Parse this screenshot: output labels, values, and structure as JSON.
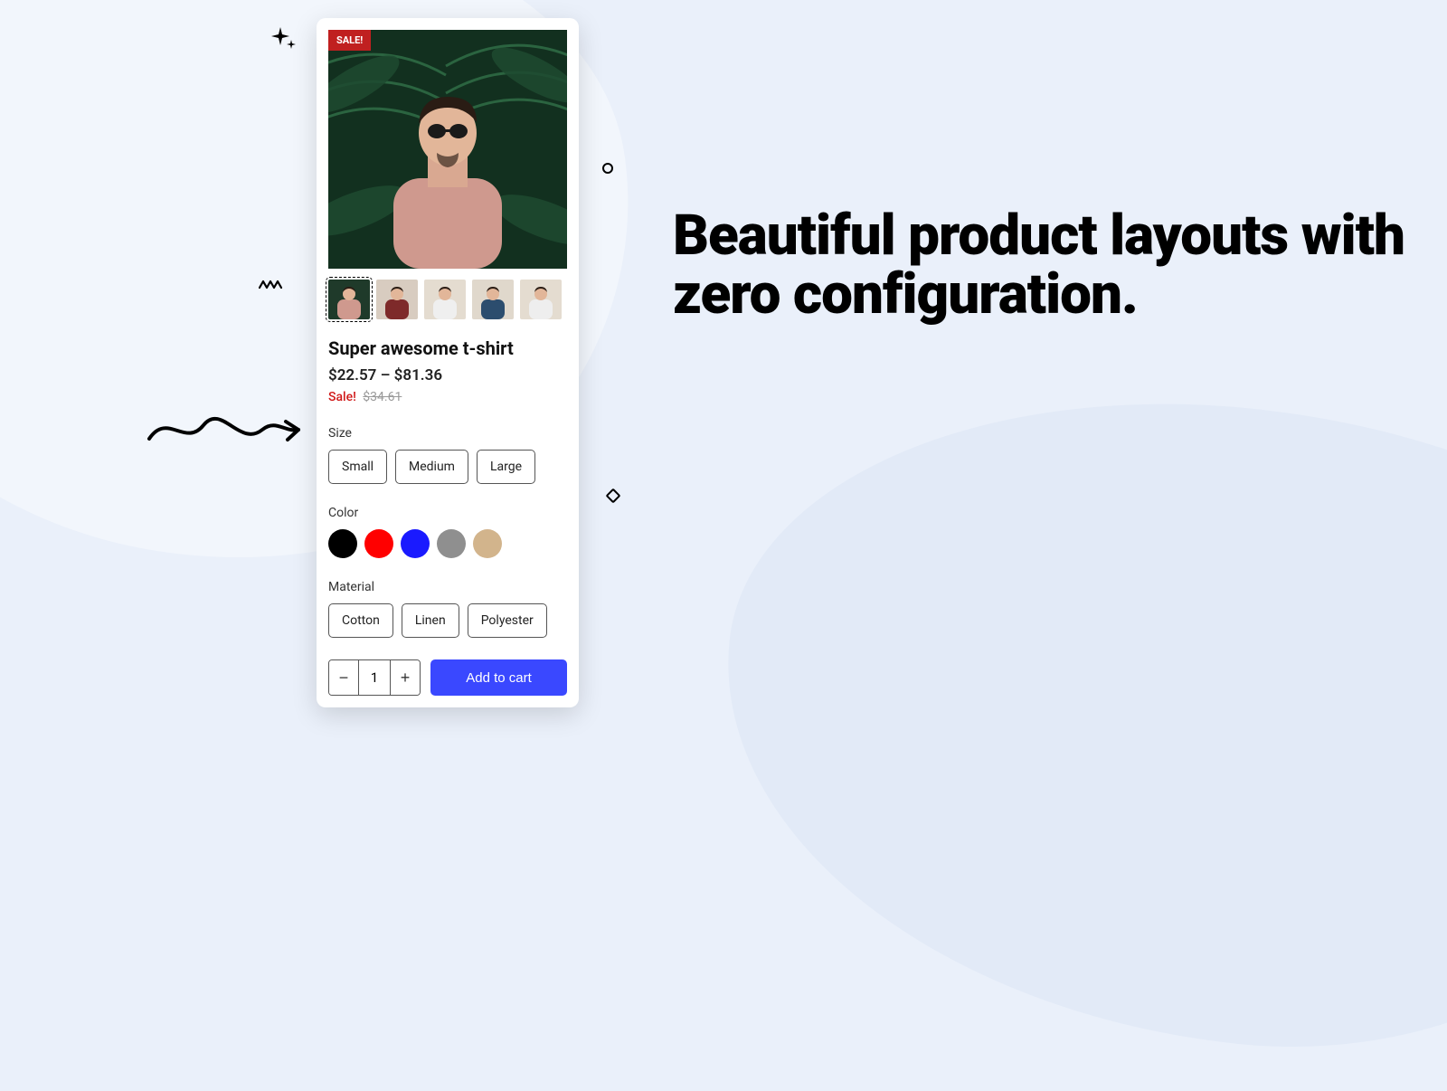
{
  "headline": "Beautiful product layouts with zero configuration.",
  "product": {
    "sale_badge": "SALE!",
    "title": "Super awesome t-shirt",
    "price_range": "$22.57 – $81.36",
    "sale_label": "Sale!",
    "original_price": "$34.61",
    "thumbnails": [
      {
        "bg": "#1f3a2a",
        "shirt": "#cf998e",
        "active": true
      },
      {
        "bg": "#d8ccc0",
        "shirt": "#7e2a2a",
        "active": false
      },
      {
        "bg": "#e4dcd0",
        "shirt": "#efefef",
        "active": false
      },
      {
        "bg": "#e0d8cc",
        "shirt": "#2c4d6e",
        "active": false
      },
      {
        "bg": "#e4dcd0",
        "shirt": "#eeeeee",
        "active": false
      }
    ],
    "options": {
      "size": {
        "label": "Size",
        "values": [
          "Small",
          "Medium",
          "Large"
        ]
      },
      "color": {
        "label": "Color",
        "values": [
          "#000000",
          "#ff0000",
          "#1a1aff",
          "#8f8f8f",
          "#d2b48c"
        ]
      },
      "material": {
        "label": "Material",
        "values": [
          "Cotton",
          "Linen",
          "Polyester"
        ]
      }
    },
    "quantity": "1",
    "add_to_cart": "Add to cart"
  }
}
